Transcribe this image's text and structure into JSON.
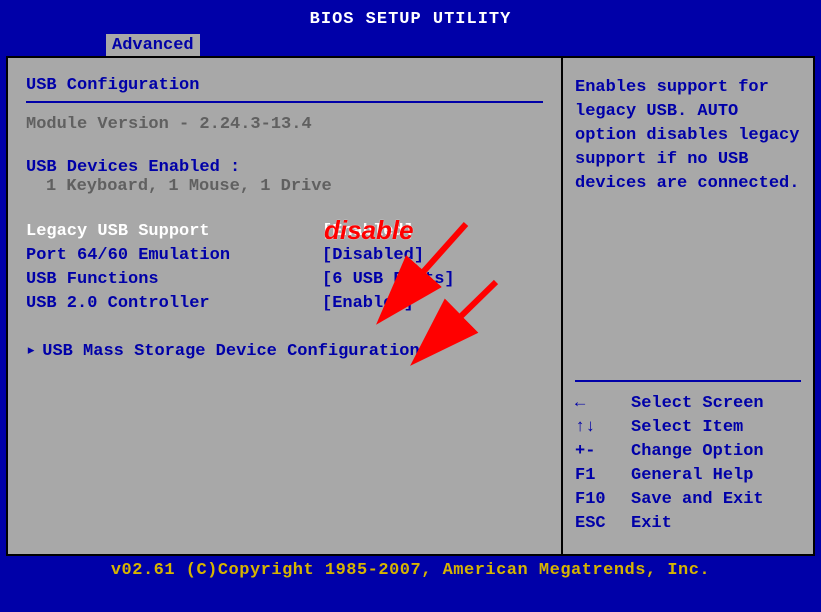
{
  "title": "BIOS SETUP UTILITY",
  "tabs": {
    "active": "Advanced"
  },
  "left": {
    "section_title": "USB Configuration",
    "module_version_label": "Module Version - 2.24.3-13.4",
    "devices_enabled_label": "USB Devices Enabled :",
    "devices_enabled_value": "1 Keyboard, 1 Mouse, 1 Drive",
    "options": [
      {
        "label": "Legacy USB Support",
        "value": "[Enabled]",
        "selected": true
      },
      {
        "label": "Port 64/60 Emulation",
        "value": "[Disabled]",
        "selected": false
      },
      {
        "label": "USB Functions",
        "value": "[6 USB Ports]",
        "selected": false
      },
      {
        "label": "USB 2.0 Controller",
        "value": "[Enabled]",
        "selected": false
      }
    ],
    "submenu_label": "USB Mass Storage Device Configuration"
  },
  "right": {
    "help": "Enables support for legacy USB. AUTO option disables legacy support if no USB devices are connected.",
    "nav": [
      {
        "key": "←",
        "desc": "Select Screen"
      },
      {
        "key": "↑↓",
        "desc": "Select Item"
      },
      {
        "key": "+-",
        "desc": "Change Option"
      },
      {
        "key": "F1",
        "desc": "General Help"
      },
      {
        "key": "F10",
        "desc": "Save and Exit"
      },
      {
        "key": "ESC",
        "desc": "Exit"
      }
    ]
  },
  "annotation": {
    "text": "disable"
  },
  "footer": "v02.61 (C)Copyright 1985-2007, American Megatrends, Inc."
}
